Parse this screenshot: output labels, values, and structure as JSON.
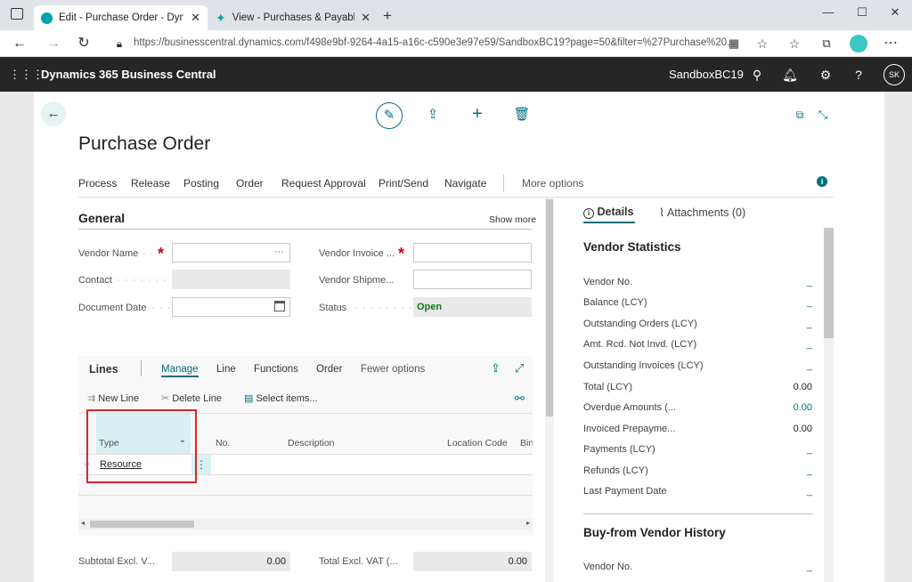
{
  "browser": {
    "tabs": [
      {
        "title": "Edit - Purchase Order - Dynamics"
      },
      {
        "title": "View - Purchases & Payables Setu"
      }
    ],
    "new_tab": "+",
    "url": "https://businesscentral.dynamics.com/f498e9bf-9264-4a15-a16c-c590e3e97e59/SandboxBC19?page=50&filter=%27Purchase%20...",
    "window_controls": {
      "minimize": "—",
      "maximize": "☐",
      "close": "✕"
    }
  },
  "app": {
    "title": "Dynamics 365 Business Central",
    "environment": "SandboxBC19",
    "user_initials": "SK"
  },
  "page": {
    "title": "Purchase Order",
    "actions": [
      "Process",
      "Release",
      "Posting",
      "Order",
      "Request Approval",
      "Print/Send",
      "Navigate"
    ],
    "more_options": "More options"
  },
  "general": {
    "header": "General",
    "show_more": "Show more",
    "fields": {
      "vendor_name": {
        "label": "Vendor Name",
        "value": ""
      },
      "contact": {
        "label": "Contact",
        "value": ""
      },
      "document_date": {
        "label": "Document Date",
        "value": ""
      },
      "vendor_invoice": {
        "label": "Vendor Invoice ...",
        "value": ""
      },
      "vendor_shipment": {
        "label": "Vendor Shipme...",
        "value": ""
      },
      "status": {
        "label": "Status",
        "value": "Open"
      }
    },
    "ellipsis": "···"
  },
  "lines": {
    "title": "Lines",
    "tabs": [
      "Manage",
      "Line",
      "Functions",
      "Order",
      "Fewer options"
    ],
    "active_tab": "Manage",
    "actions": [
      "New Line",
      "Delete Line",
      "Select items..."
    ],
    "columns": [
      "Type",
      "No.",
      "Description",
      "Location Code",
      "Bin"
    ],
    "rows": [
      {
        "type": "Resource",
        "no": "",
        "description": "",
        "location_code": ""
      }
    ]
  },
  "totals": {
    "subtotal_label": "Subtotal Excl. V...",
    "subtotal_value": "0.00",
    "total_label": "Total Excl. VAT (...",
    "total_value": "0.00"
  },
  "factbox": {
    "tabs": {
      "details": "Details",
      "attachments": "Attachments (0)"
    },
    "vendor_statistics": {
      "header": "Vendor Statistics",
      "rows": [
        {
          "label": "Vendor No.",
          "value": "_"
        },
        {
          "label": "Balance (LCY)",
          "value": "_"
        },
        {
          "label": "Outstanding Orders (LCY)",
          "value": "_"
        },
        {
          "label": "Amt. Rcd. Not Invd. (LCY)",
          "value": "_"
        },
        {
          "label": "Outstanding Invoices (LCY)",
          "value": "_"
        },
        {
          "label": "Total (LCY)",
          "value": "0.00"
        },
        {
          "label": "Overdue Amounts (...",
          "value": "0.00"
        },
        {
          "label": "Invoiced Prepayme...",
          "value": "0.00"
        },
        {
          "label": "Payments (LCY)",
          "value": "_"
        },
        {
          "label": "Refunds (LCY)",
          "value": "_"
        },
        {
          "label": "Last Payment Date",
          "value": "_"
        }
      ]
    },
    "buy_from_history": {
      "header": "Buy-from Vendor History",
      "rows": [
        {
          "label": "Vendor No.",
          "value": "_"
        }
      ]
    }
  },
  "colors": {
    "accent": "#00707a",
    "header_bg": "#262626",
    "status_green": "#107c10",
    "highlight": "#d8f0f2",
    "annotation_red": "#d9262b"
  }
}
